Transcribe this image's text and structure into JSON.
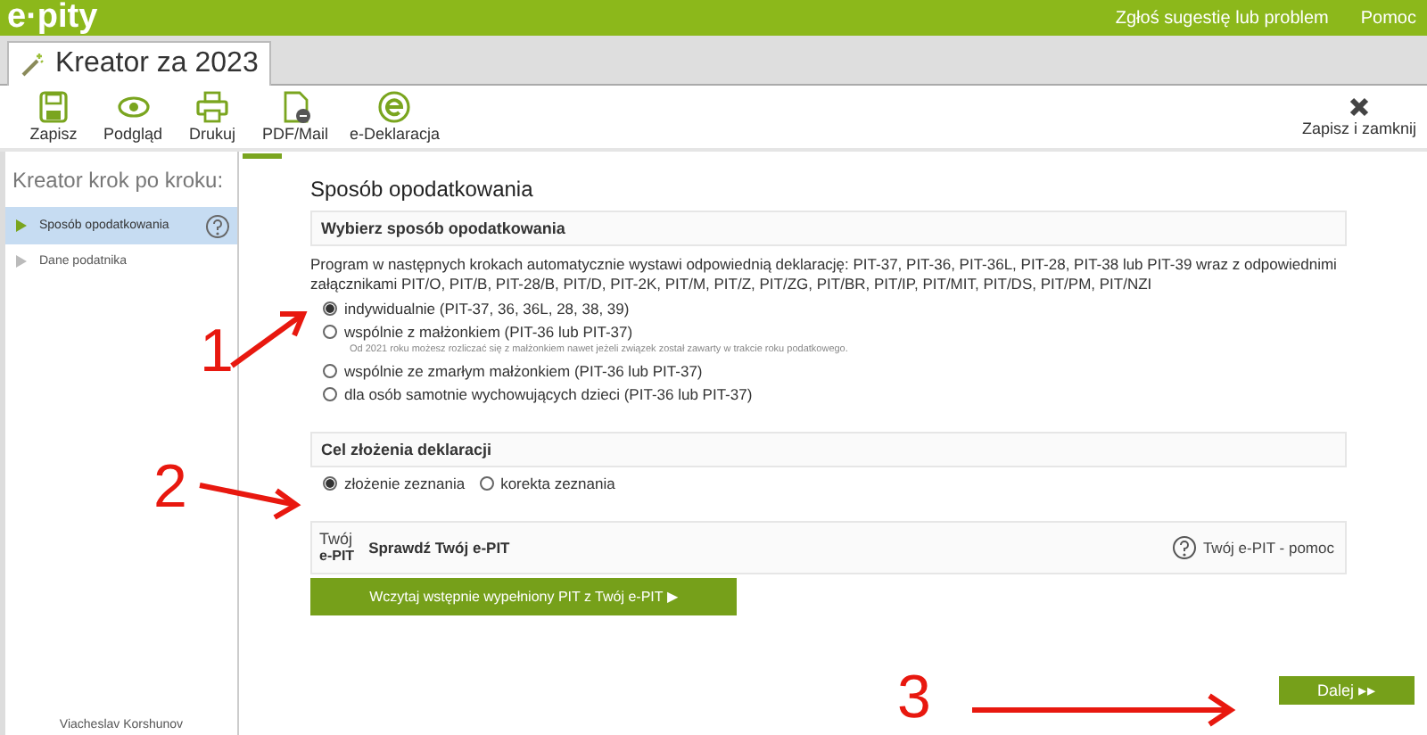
{
  "header": {
    "logo": "e·pity",
    "links": [
      "Zgłoś sugestię lub problem",
      "Pomoc"
    ]
  },
  "tab": {
    "title": "Kreator za 2023"
  },
  "toolbar": {
    "buttons": [
      {
        "kind": "save",
        "label": "Zapisz"
      },
      {
        "kind": "preview",
        "label": "Podgląd"
      },
      {
        "kind": "print",
        "label": "Drukuj"
      },
      {
        "kind": "pdf",
        "label": "PDF/Mail"
      },
      {
        "kind": "edecl",
        "label": "e-Deklaracja"
      }
    ],
    "close": {
      "label": "Zapisz i zamknij"
    }
  },
  "sidebar": {
    "title": "Kreator krok po kroku:",
    "items": [
      {
        "label": "Sposób opodatkowania",
        "selected": true
      },
      {
        "label": "Dane podatnika",
        "selected": false
      }
    ],
    "user": "Viacheslav Korshunov"
  },
  "content": {
    "title": "Sposób opodatkowania",
    "section1": {
      "heading": "Wybierz sposób opodatkowania",
      "text": "Program w następnych krokach automatycznie wystawi odpowiednią deklarację: PIT-37, PIT-36, PIT-36L, PIT-28, PIT-38 lub PIT-39 wraz z odpowiednimi załącznikami PIT/O, PIT/B, PIT-28/B, PIT/D, PIT-2K, PIT/M, PIT/Z, PIT/ZG, PIT/BR, PIT/IP, PIT/MIT, PIT/DS, PIT/PM, PIT/NZI",
      "options": [
        {
          "label": "indywidualnie (PIT-37, 36, 36L, 28, 38, 39)",
          "selected": true
        },
        {
          "label": "wspólnie z małżonkiem (PIT-36 lub PIT-37)",
          "selected": false,
          "note": "Od 2021 roku możesz rozliczać się z małżonkiem nawet jeżeli związek został zawarty w trakcie roku podatkowego."
        },
        {
          "label": "wspólnie ze zmarłym małżonkiem (PIT-36 lub PIT-37)",
          "selected": false
        },
        {
          "label": "dla osób samotnie wychowujących dzieci (PIT-36 lub PIT-37)",
          "selected": false
        }
      ]
    },
    "section2": {
      "heading": "Cel złożenia deklaracji",
      "options": [
        {
          "label": "złożenie zeznania",
          "selected": true
        },
        {
          "label": "korekta zeznania",
          "selected": false
        }
      ]
    },
    "epit": {
      "logo_top": "Twój",
      "logo_bottom": "e-PIT",
      "title": "Sprawdź Twój e-PIT",
      "help": "Twój e-PIT - pomoc",
      "button": "Wczytaj wstępnie wypełniony PIT z Twój e-PIT ▶"
    },
    "next_button": "Dalej ▸▸"
  },
  "annotations": [
    {
      "label": "1"
    },
    {
      "label": "2"
    },
    {
      "label": "3"
    }
  ]
}
